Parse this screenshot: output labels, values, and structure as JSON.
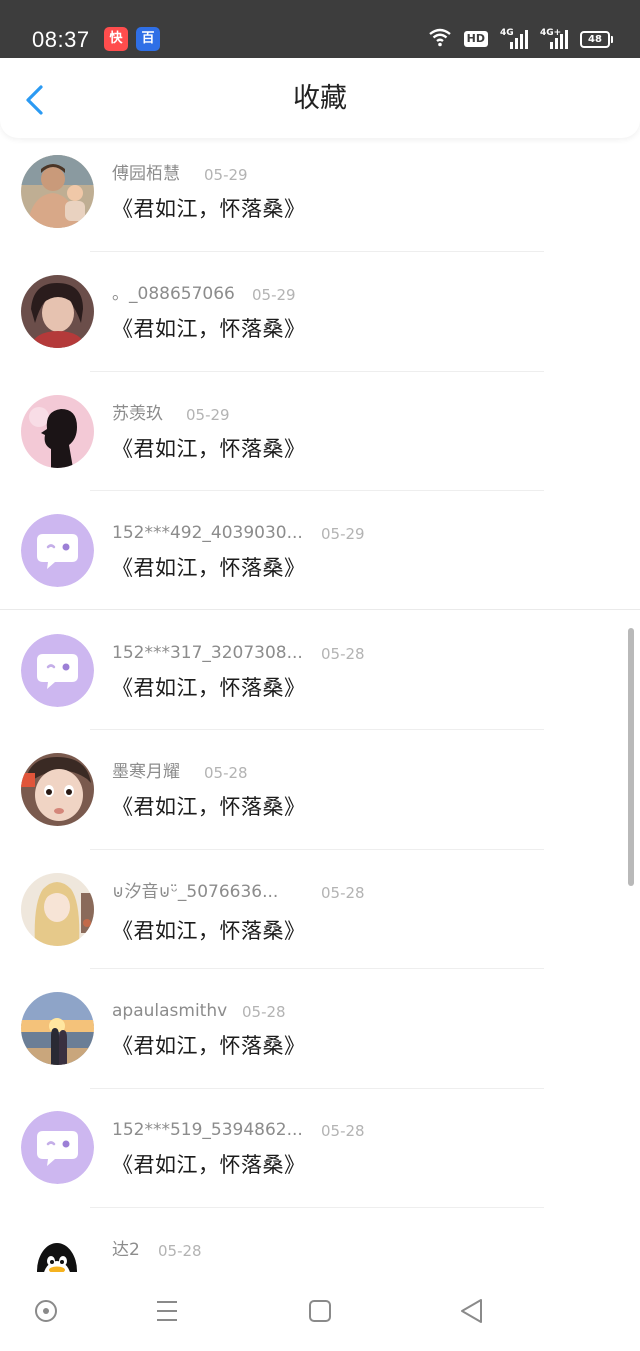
{
  "status_bar": {
    "time": "08:37",
    "notifications": [
      {
        "name": "kuaishou-app-icon",
        "glyph": "快",
        "color": "#ff4d4d"
      },
      {
        "name": "baidu-app-icon",
        "glyph": "百",
        "color": "#2f6fe6"
      }
    ],
    "hd_label": "HD",
    "network_1": "4G",
    "network_2": "4G+",
    "battery": "48"
  },
  "header": {
    "title": "收藏",
    "accent_color": "#2b9af3"
  },
  "favorites": [
    {
      "user": "傅园栢慧",
      "date": "05-29",
      "title": "《君如江，怀落桑》",
      "avatar": "photo-man-with-child"
    },
    {
      "user": "。_088657066",
      "date": "05-29",
      "title": "《君如江，怀落桑》",
      "avatar": "photo-boy-portrait"
    },
    {
      "user": "苏羡玖",
      "date": "05-29",
      "title": "《君如江，怀落桑》",
      "avatar": "photo-silhouette"
    },
    {
      "user": "152***492_4039030...",
      "date": "05-29",
      "title": "《君如江，怀落桑》",
      "avatar": "default-chat-avatar"
    },
    {
      "user": "152***317_3207308...",
      "date": "05-28",
      "title": "《君如江，怀落桑》",
      "avatar": "default-chat-avatar"
    },
    {
      "user": "墨寒月耀",
      "date": "05-28",
      "title": "《君如江，怀落桑》",
      "avatar": "photo-boy-closeup"
    },
    {
      "user": "⊍汐音⊍ᵕ̈_5076636...",
      "date": "05-28",
      "title": "《君如江，怀落桑》",
      "avatar": "photo-anime-girl"
    },
    {
      "user": "apaulasmithv",
      "date": "05-28",
      "title": "《君如江，怀落桑》",
      "avatar": "photo-couple-beach"
    },
    {
      "user": "152***519_5394862...",
      "date": "05-28",
      "title": "《君如江，怀落桑》",
      "avatar": "default-chat-avatar"
    },
    {
      "user": "达2",
      "date": "05-28",
      "title": "",
      "avatar": "qq-penguin"
    }
  ],
  "nav_bar": {
    "buttons": [
      "assistant-circle-button",
      "menu-button",
      "home-button",
      "back-triangle-button"
    ]
  }
}
